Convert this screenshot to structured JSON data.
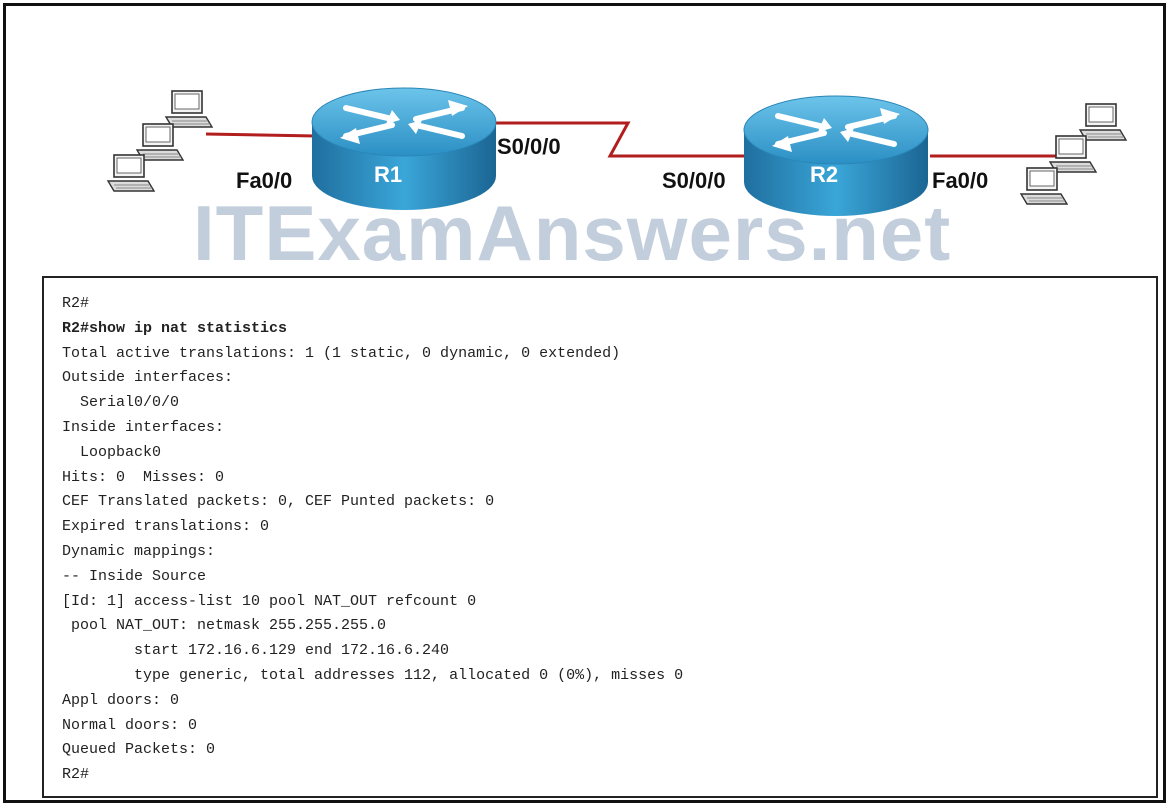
{
  "topology": {
    "routers": [
      {
        "name": "R1"
      },
      {
        "name": "R2"
      }
    ],
    "interface_labels": {
      "r1_fa": "Fa0/0",
      "r1_serial": "S0/0/0",
      "r2_serial": "S0/0/0",
      "r2_fa": "Fa0/0"
    },
    "link_color": "#b21d1d",
    "router_color": "#2d9ad0"
  },
  "watermark": "ITExamAnswers.net",
  "cli": {
    "lines": [
      {
        "text": "R2#",
        "bold": false
      },
      {
        "text": "R2#show ip nat statistics",
        "bold": true
      },
      {
        "text": "Total active translations: 1 (1 static, 0 dynamic, 0 extended)",
        "bold": false
      },
      {
        "text": "Outside interfaces:",
        "bold": false
      },
      {
        "text": "  Serial0/0/0",
        "bold": false
      },
      {
        "text": "Inside interfaces:",
        "bold": false
      },
      {
        "text": "  Loopback0",
        "bold": false
      },
      {
        "text": "Hits: 0  Misses: 0",
        "bold": false
      },
      {
        "text": "CEF Translated packets: 0, CEF Punted packets: 0",
        "bold": false
      },
      {
        "text": "Expired translations: 0",
        "bold": false
      },
      {
        "text": "Dynamic mappings:",
        "bold": false
      },
      {
        "text": "-- Inside Source",
        "bold": false
      },
      {
        "text": "[Id: 1] access-list 10 pool NAT_OUT refcount 0",
        "bold": false
      },
      {
        "text": " pool NAT_OUT: netmask 255.255.255.0",
        "bold": false
      },
      {
        "text": "        start 172.16.6.129 end 172.16.6.240",
        "bold": false
      },
      {
        "text": "        type generic, total addresses 112, allocated 0 (0%), misses 0",
        "bold": false
      },
      {
        "text": "Appl doors: 0",
        "bold": false
      },
      {
        "text": "Normal doors: 0",
        "bold": false
      },
      {
        "text": "Queued Packets: 0",
        "bold": false
      },
      {
        "text": "R2#",
        "bold": false
      }
    ]
  }
}
